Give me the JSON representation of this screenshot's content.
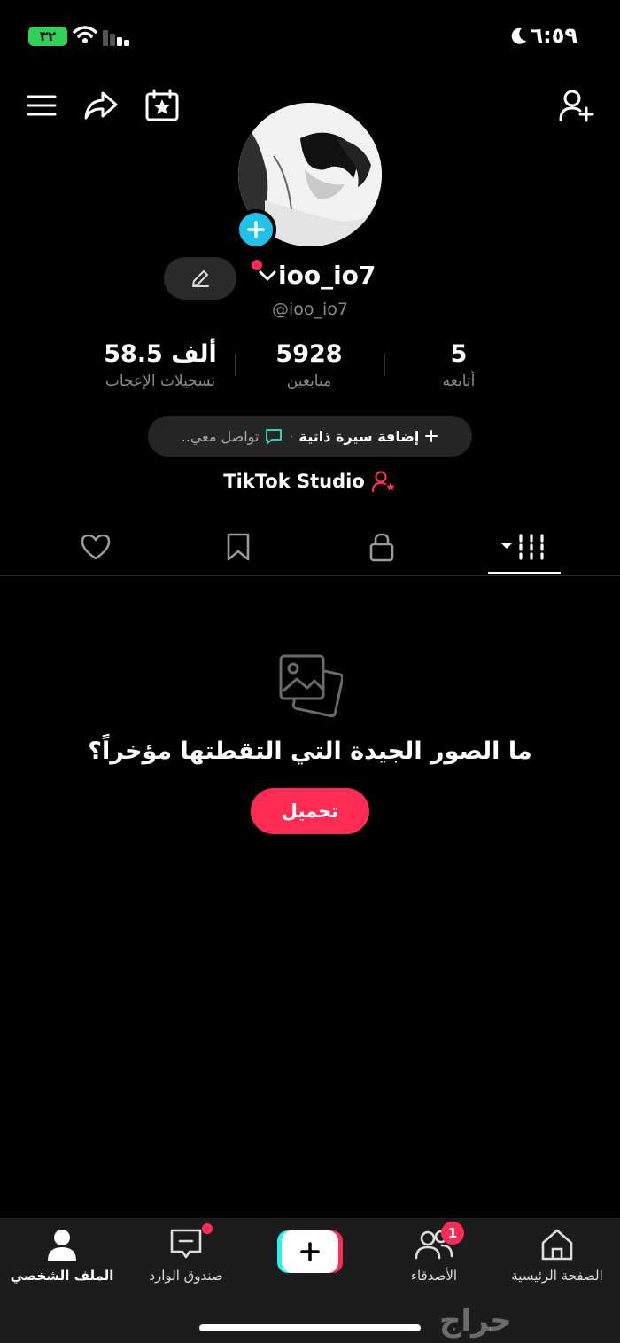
{
  "status_bar": {
    "time": "٦:٥٩",
    "battery": "٣٢"
  },
  "profile": {
    "display_name": "ioo_io7",
    "handle": "@ioo_io7",
    "stats": [
      {
        "value": "58.5 ألف",
        "label": "تسجيلات الإعجاب"
      },
      {
        "value": "5928",
        "label": "متابعين"
      },
      {
        "value": "5",
        "label": "أتابعه"
      }
    ],
    "bio_add": "إضافة سيرة ذاتية",
    "bio_separator": "·",
    "bio_contact": "تواصل معي..",
    "studio_label": "TikTok Studio"
  },
  "tabs": [
    {
      "icon": "heart-icon"
    },
    {
      "icon": "bookmark-icon"
    },
    {
      "icon": "lock-icon"
    },
    {
      "icon": "grid-icon",
      "active": true
    }
  ],
  "empty_state": {
    "title": "ما الصور الجيدة التي التقطتها مؤخراً؟",
    "button": "تحميل"
  },
  "bottom_nav": {
    "profile": "الملف الشخصي",
    "inbox": "صندوق الوارد",
    "friends": "الأصدقاء",
    "friends_badge": "1",
    "home": "الصفحة الرئيسية"
  },
  "watermark": "حراج",
  "colors": {
    "accent": "#fe2c55",
    "cyan": "#25f4ee",
    "avatar_plus": "#20c2ec",
    "chat": "#2ed3b7"
  }
}
